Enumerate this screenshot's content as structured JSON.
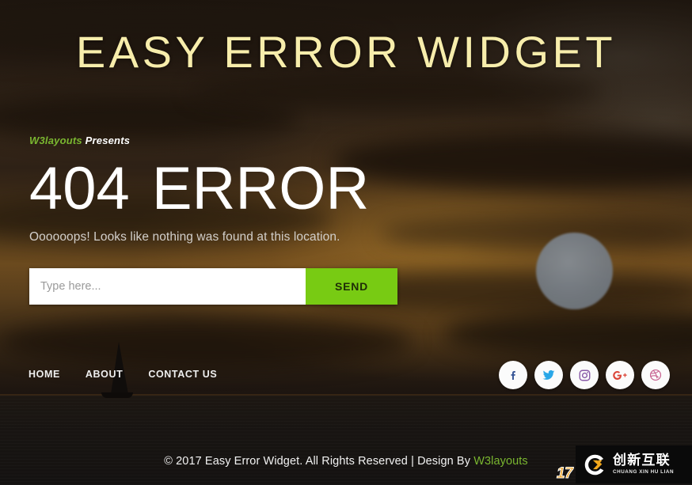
{
  "site": {
    "title": "EASY ERROR WIDGET"
  },
  "hero": {
    "presents_brand": "W3layouts",
    "presents_suffix": "Presents",
    "error_code": "404",
    "error_word": "ERROR",
    "subtitle": "Oooooops! Looks like nothing was found at this location."
  },
  "search": {
    "placeholder": "Type here...",
    "value": "",
    "submit_label": "SEND"
  },
  "nav": {
    "items": [
      {
        "label": "HOME",
        "name": "nav-link-home"
      },
      {
        "label": "ABOUT",
        "name": "nav-link-about"
      },
      {
        "label": "CONTACT  US",
        "name": "nav-link-contact-us"
      }
    ]
  },
  "social": {
    "items": [
      {
        "icon": "facebook-icon",
        "label": "Facebook",
        "color": "#3b5998"
      },
      {
        "icon": "twitter-icon",
        "label": "Twitter",
        "color": "#1da1f2"
      },
      {
        "icon": "instagram-icon",
        "label": "Instagram",
        "color": "#8a5ba8"
      },
      {
        "icon": "google-plus-icon",
        "label": "Google Plus",
        "color": "#db4437"
      },
      {
        "icon": "dribbble-icon",
        "label": "Dribbble",
        "color": "#c7608f"
      }
    ]
  },
  "footer": {
    "text_before": "© 2017 Easy Error Widget. All Rights Reserved | Design By ",
    "brand": "W3layouts"
  },
  "watermark": {
    "badge_number": "17",
    "logo_cn": "创新互联",
    "logo_pinyin": "CHUANG XIN HU LIAN"
  },
  "colors": {
    "title": "#f7edab",
    "accent_green": "#7ab730",
    "button_green": "#78cb13",
    "text_white": "#ffffff",
    "subtitle_grey": "#d2cfcb",
    "watermark_orange": "#f5a623",
    "background_dark": "#241a12"
  }
}
